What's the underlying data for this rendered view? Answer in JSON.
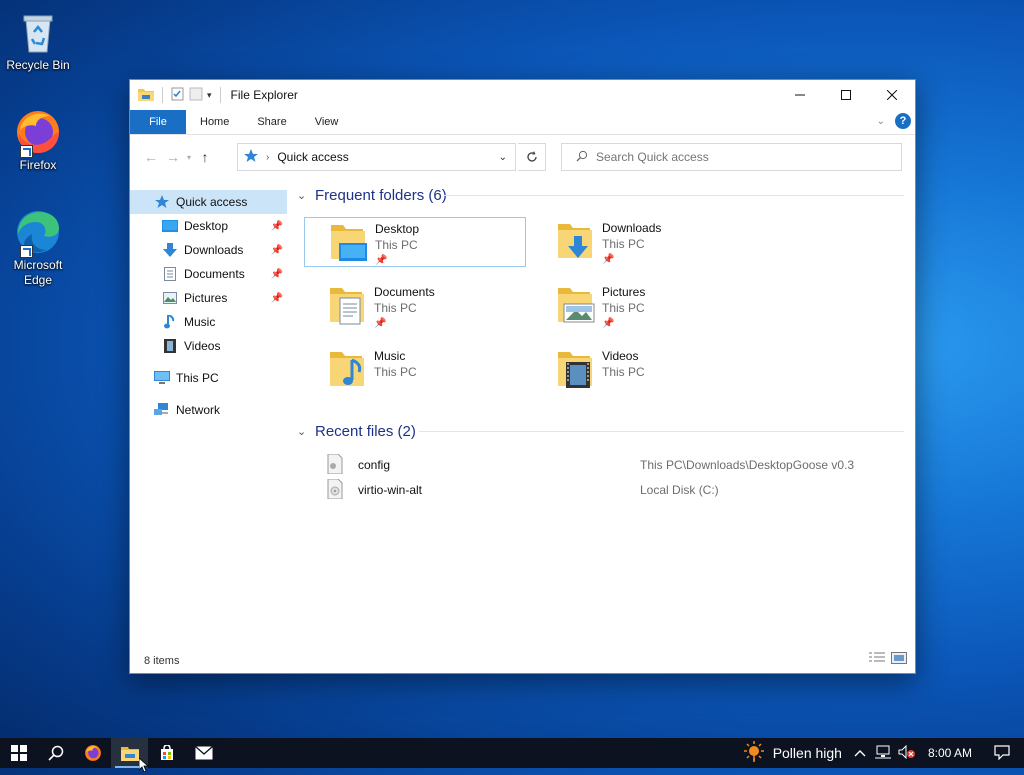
{
  "desktop": {
    "icons": [
      {
        "label": "Recycle Bin"
      },
      {
        "label": "Firefox"
      },
      {
        "label": "Microsoft Edge"
      }
    ]
  },
  "window": {
    "title": "File Explorer",
    "ribbon_tabs": [
      "File",
      "Home",
      "Share",
      "View"
    ],
    "address": {
      "current": "Quick access"
    },
    "search": {
      "placeholder": "Search Quick access"
    }
  },
  "sidebar": {
    "items": [
      {
        "label": "Quick access",
        "icon": "star-icon",
        "selected": true
      },
      {
        "label": "Desktop",
        "icon": "desktop-icon",
        "pinned": true
      },
      {
        "label": "Downloads",
        "icon": "downloads-icon",
        "pinned": true
      },
      {
        "label": "Documents",
        "icon": "documents-icon",
        "pinned": true
      },
      {
        "label": "Pictures",
        "icon": "pictures-icon",
        "pinned": true
      },
      {
        "label": "Music",
        "icon": "music-icon"
      },
      {
        "label": "Videos",
        "icon": "videos-icon"
      },
      {
        "label": "This PC",
        "icon": "computer-icon"
      },
      {
        "label": "Network",
        "icon": "network-icon"
      }
    ]
  },
  "frequent": {
    "heading": "Frequent folders (6)",
    "folders": [
      {
        "name": "Desktop",
        "location": "This PC",
        "pinned": true
      },
      {
        "name": "Downloads",
        "location": "This PC",
        "pinned": true
      },
      {
        "name": "Documents",
        "location": "This PC",
        "pinned": true
      },
      {
        "name": "Pictures",
        "location": "This PC",
        "pinned": true
      },
      {
        "name": "Music",
        "location": "This PC",
        "pinned": false
      },
      {
        "name": "Videos",
        "location": "This PC",
        "pinned": false
      }
    ]
  },
  "recent": {
    "heading": "Recent files (2)",
    "files": [
      {
        "name": "config",
        "location": "This PC\\Downloads\\DesktopGoose v0.3"
      },
      {
        "name": "virtio-win-alt",
        "location": "Local Disk (C:)"
      }
    ]
  },
  "status": {
    "items": "8 items"
  },
  "taskbar": {
    "weather": "Pollen high",
    "time": "8:00 AM"
  },
  "colors": {
    "accent": "#1a6fc5",
    "heading": "#1e3287",
    "selection": "#cce4f7"
  }
}
